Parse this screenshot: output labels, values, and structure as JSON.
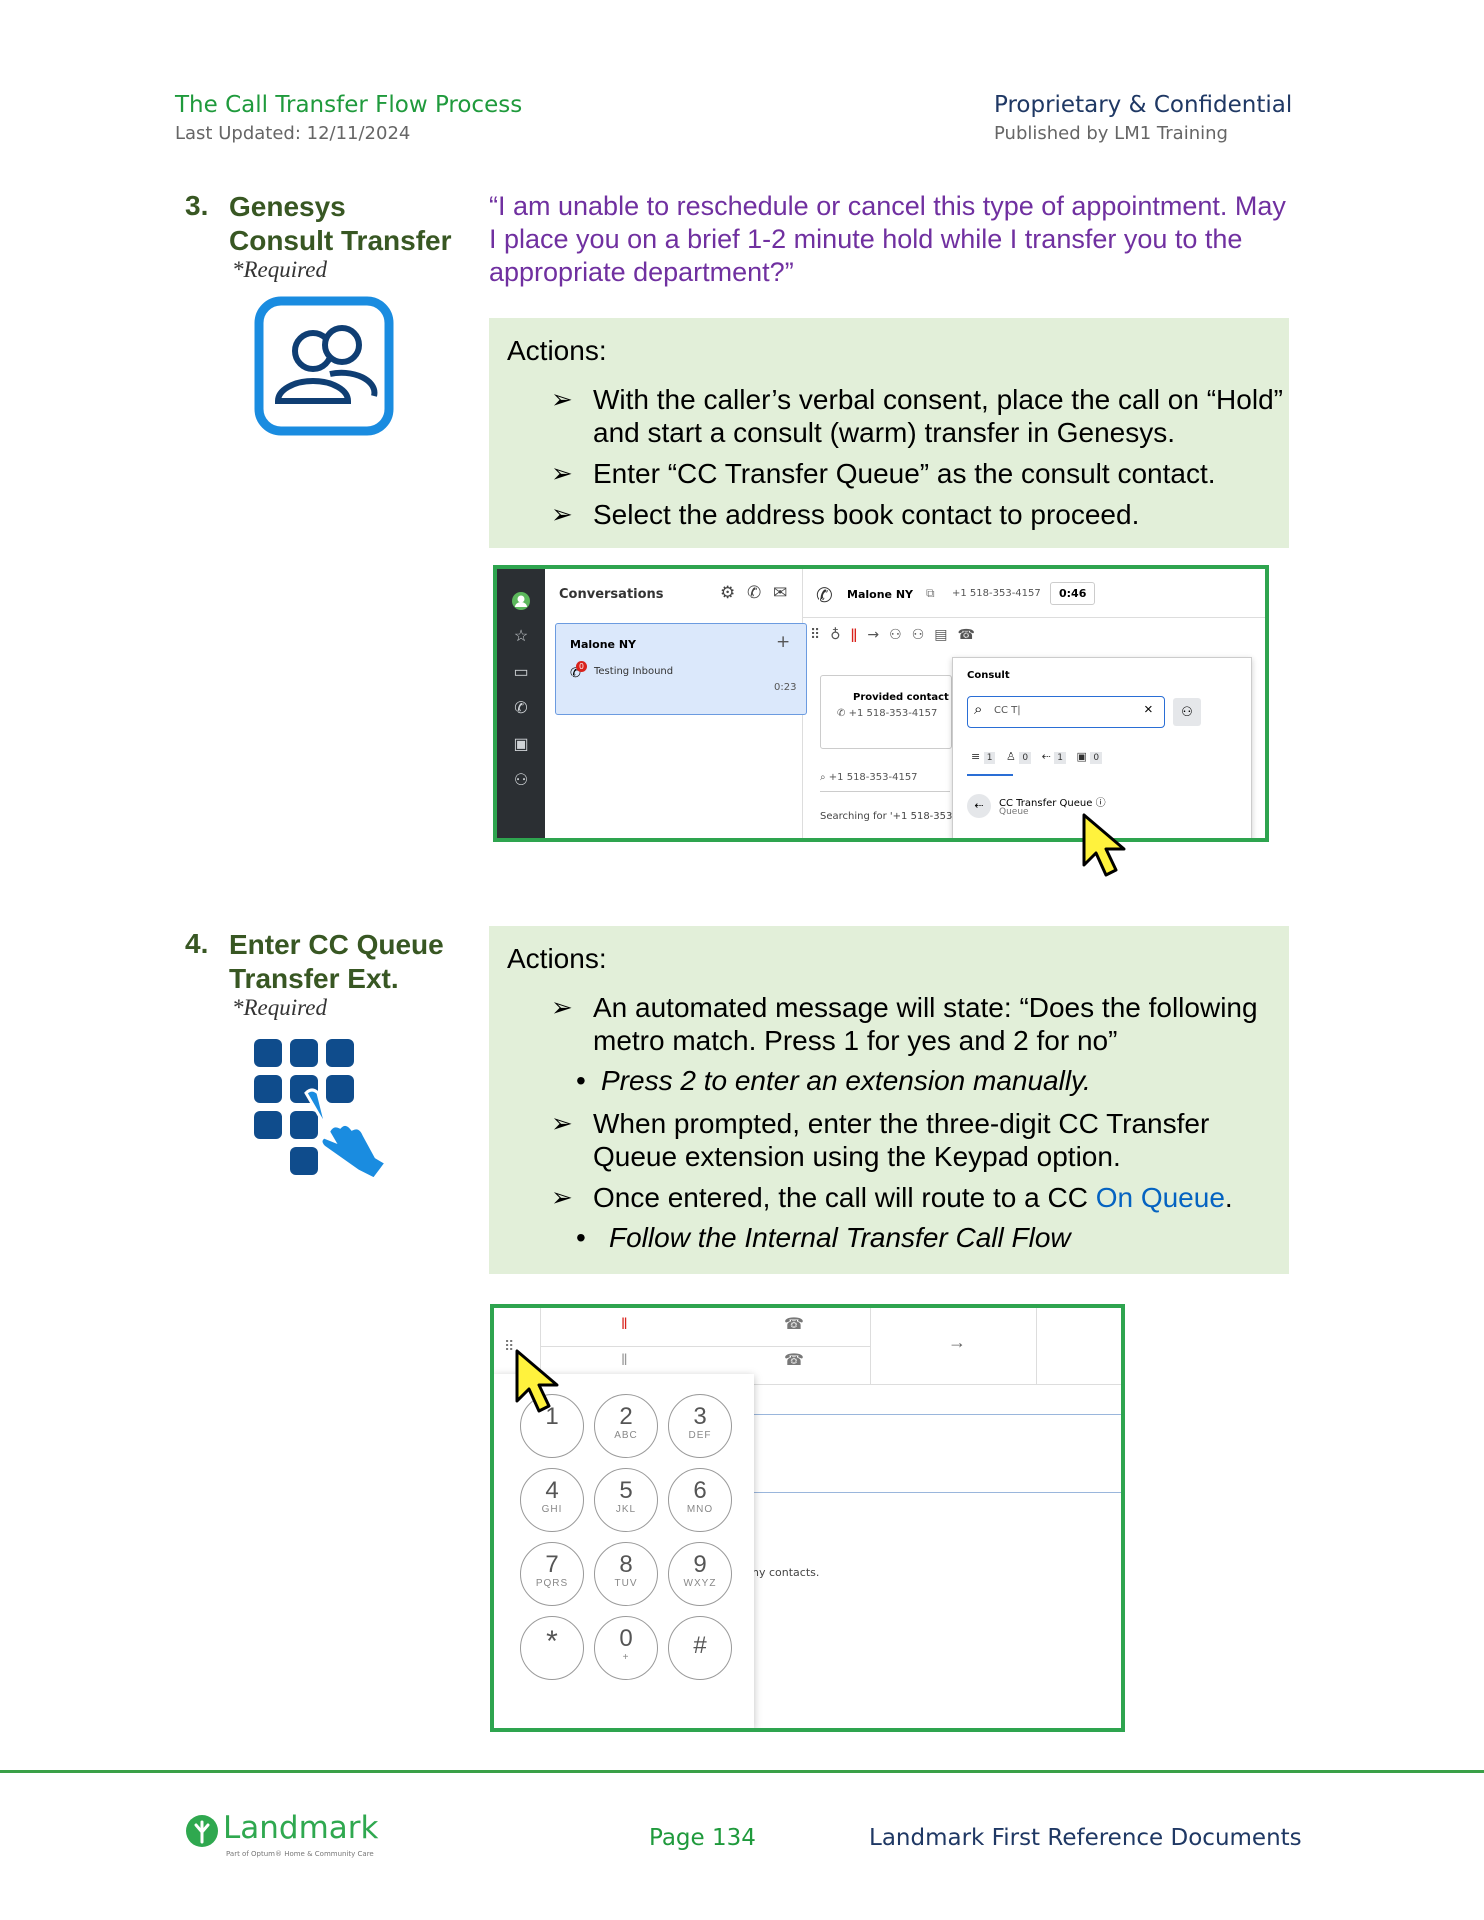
{
  "header": {
    "title": "The Call Transfer Flow Process",
    "last_updated": "Last Updated: 12/11/2024",
    "confidential": "Proprietary & Confidential",
    "published": "Published by LM1 Training"
  },
  "step3": {
    "number": "3.",
    "title_line1": "Genesys",
    "title_line2": "Consult Transfer",
    "required": "*Required",
    "quote": "“I am unable to reschedule or cancel this type of appointment. May I place you on a brief 1-2 minute hold while I transfer you to the appropriate department?”",
    "actions_label": "Actions:",
    "actions": [
      "With the caller’s verbal consent, place the call on “Hold” and start a consult (warm) transfer in Genesys.",
      "Enter “CC Transfer Queue” as the consult contact.",
      "Select the address book contact to proceed."
    ],
    "screenshot": {
      "conversations": "Conversations",
      "contact_name": "Malone NY",
      "card_status": "Testing Inbound",
      "card_timer": "0:23",
      "badge": "0",
      "call_name": "Malone NY",
      "call_number": "+1 518-353-4157",
      "call_timer": "0:46",
      "provided_contact": "Provided contact i",
      "provided_number": "+1 518-353-4157",
      "search_number": "+1 518-353-4157",
      "searching": "Searching for '+1 518-353",
      "consult_title": "Consult",
      "search_value": "CC T|",
      "filter_all": "1",
      "filter_people": "0",
      "filter_queues": "1",
      "filter_external": "0",
      "result_name": "CC Transfer Queue",
      "result_type": "Queue"
    }
  },
  "step4": {
    "number": "4.",
    "title_line1": "Enter CC Queue",
    "title_line2": "Transfer Ext.",
    "required": "*Required",
    "actions_label": "Actions:",
    "action1": "An automated message will state: “Does the following metro match. Press 1 for yes and 2 for no”",
    "action1_sub": "Press 2 to enter an extension manually.",
    "action2": "When prompted, enter the three-digit CC Transfer Queue extension using the Keypad option.",
    "action3_pre": "Once entered, the call will route to a CC ",
    "action3_link": "On Queue",
    "action3_post": ".",
    "action3_sub": "Follow the Internal Transfer Call Flow",
    "screenshot": {
      "contacts_text": "ny contacts.",
      "keys": [
        {
          "digit": "1",
          "letters": ""
        },
        {
          "digit": "2",
          "letters": "ABC"
        },
        {
          "digit": "3",
          "letters": "DEF"
        },
        {
          "digit": "4",
          "letters": "GHI"
        },
        {
          "digit": "5",
          "letters": "JKL"
        },
        {
          "digit": "6",
          "letters": "MNO"
        },
        {
          "digit": "7",
          "letters": "PQRS"
        },
        {
          "digit": "8",
          "letters": "TUV"
        },
        {
          "digit": "9",
          "letters": "WXYZ"
        },
        {
          "digit": "*",
          "letters": ""
        },
        {
          "digit": "0",
          "letters": "+"
        },
        {
          "digit": "#",
          "letters": ""
        }
      ]
    }
  },
  "footer": {
    "logo_text": "Landmark",
    "logo_tagline": "Part of Optum® Home & Community Care",
    "page": "Page 134",
    "docs": "Landmark First Reference Documents"
  },
  "colors": {
    "heading_green": "#385723",
    "quote_purple": "#7030a0",
    "actions_bg": "#e2efd9",
    "screenshot_border": "#2ea44f",
    "link_blue": "#0563c1"
  }
}
